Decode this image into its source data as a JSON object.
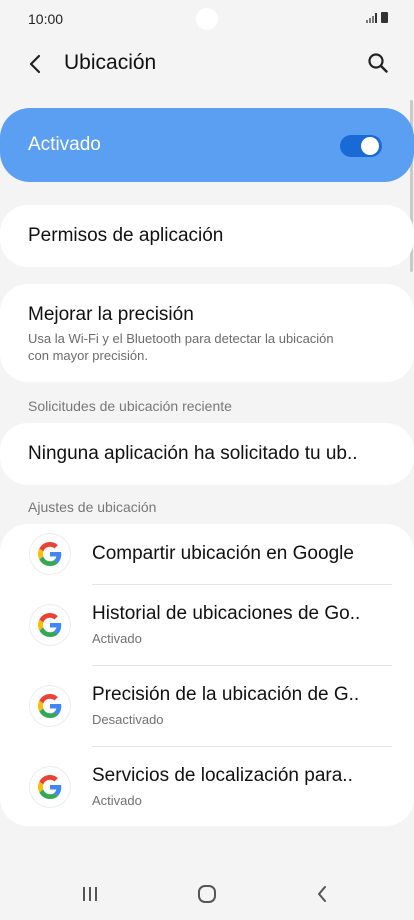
{
  "status_bar": {
    "time": "10:00"
  },
  "header": {
    "title": "Ubicación"
  },
  "master_switch": {
    "label": "Activado",
    "on": true
  },
  "app_permissions": {
    "label": "Permisos de aplicación"
  },
  "improve_accuracy": {
    "title": "Mejorar la precisión",
    "subtitle": "Usa la Wi-Fi y el Bluetooth para detectar la ubicación con mayor precisión."
  },
  "recent_requests": {
    "header": "Solicitudes de ubicación reciente",
    "message": "Ninguna aplicación ha solicitado tu ub.."
  },
  "location_services": {
    "header": "Ajustes de ubicación",
    "items": [
      {
        "title": "Compartir ubicación en Google",
        "subtitle": ""
      },
      {
        "title": "Historial de ubicaciones de Go..",
        "subtitle": "Activado"
      },
      {
        "title": "Precisión de la ubicación de G..",
        "subtitle": "Desactivado"
      },
      {
        "title": "Servicios de localización para..",
        "subtitle": "Activado"
      }
    ]
  },
  "colors": {
    "accent": "#5b9ff2",
    "toggle": "#1969d6",
    "background": "#f4f4f4"
  },
  "icons": [
    "back-arrow-icon",
    "search-icon",
    "google-g-icon",
    "recents-icon",
    "home-icon",
    "back-nav-icon"
  ]
}
